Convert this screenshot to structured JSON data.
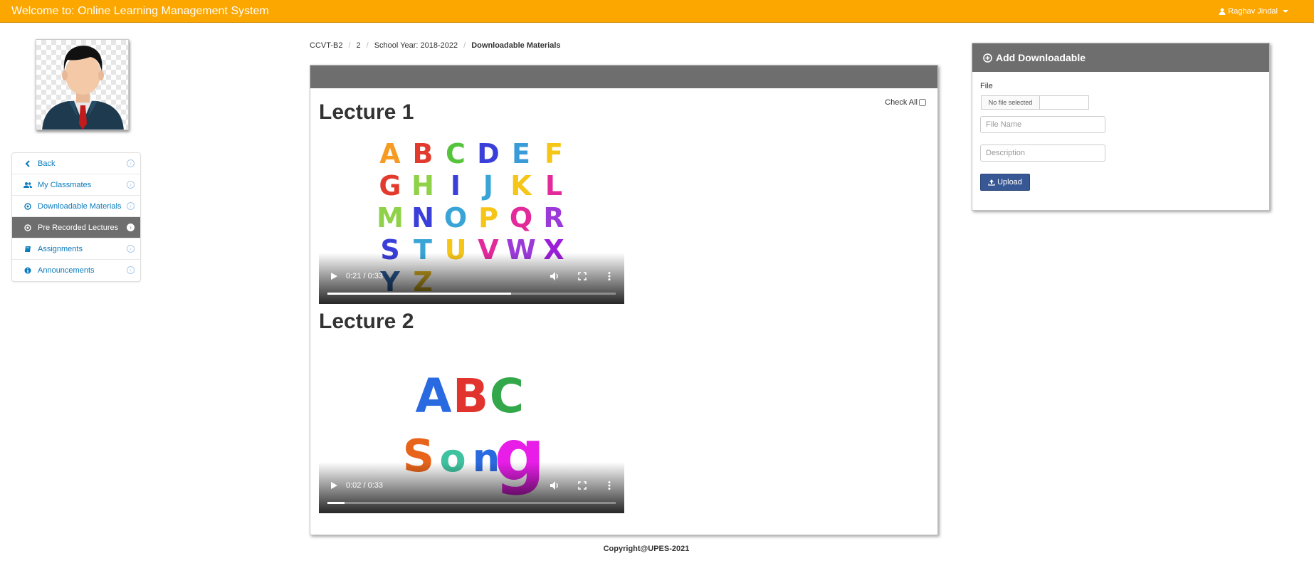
{
  "topbar": {
    "title": "Welcome to: Online Learning Management System",
    "user_name": "Raghav Jindal"
  },
  "sidenav": {
    "items": [
      {
        "label": "Back",
        "icon": "chevron-left-icon"
      },
      {
        "label": "My Classmates",
        "icon": "users-icon"
      },
      {
        "label": "Downloadable Materials",
        "icon": "download-circle-icon"
      },
      {
        "label": "Pre Recorded Lectures",
        "icon": "download-circle-icon"
      },
      {
        "label": "Assignments",
        "icon": "book-icon"
      },
      {
        "label": "Announcements",
        "icon": "info-icon"
      }
    ],
    "active_index": 3
  },
  "breadcrumb": {
    "items": [
      "CCVT-B2",
      "2",
      "School Year: 2018-2022",
      "Downloadable Materials"
    ]
  },
  "main": {
    "check_all_label": "Check All",
    "lectures": [
      {
        "title": "Lecture 1",
        "time": "0:21 / 0:33",
        "progress": 0.636
      },
      {
        "title": "Lecture 2",
        "time": "0:02 / 0:33",
        "progress": 0.06
      }
    ]
  },
  "video1_letters": [
    "A",
    "B",
    "C",
    "D",
    "E",
    "F",
    "G",
    "H",
    "I",
    "J",
    "K",
    "L",
    "M",
    "N",
    "O",
    "P",
    "Q",
    "R",
    "S",
    "T",
    "U",
    "V",
    "W",
    "X",
    "Y",
    "Z"
  ],
  "video2_letters": [
    "A",
    "B",
    "C",
    "S",
    "o",
    "n",
    "g"
  ],
  "side_panel": {
    "title": "Add Downloadable",
    "file_label": "File",
    "file_button": "No file selected",
    "file_name_placeholder": "File Name",
    "description_placeholder": "Description",
    "upload_label": "Upload"
  },
  "footer": {
    "text": "Copyright@UPES-2021"
  },
  "colors": {
    "topbar": "#fca600",
    "panel_header": "#6e6e6e",
    "link": "#0a7bbd",
    "upload_button": "#385895"
  }
}
